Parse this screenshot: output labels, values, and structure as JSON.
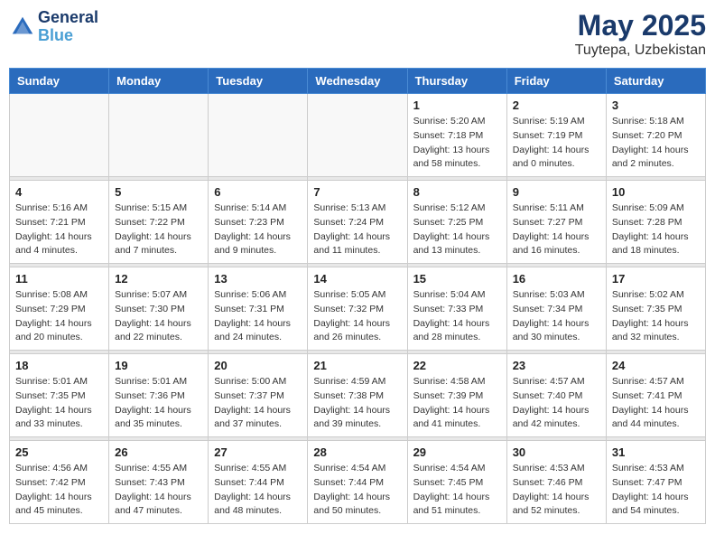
{
  "header": {
    "logo_line1": "General",
    "logo_line2": "Blue",
    "month_title": "May 2025",
    "location": "Tuytepa, Uzbekistan"
  },
  "days_of_week": [
    "Sunday",
    "Monday",
    "Tuesday",
    "Wednesday",
    "Thursday",
    "Friday",
    "Saturday"
  ],
  "weeks": [
    {
      "days": [
        {
          "num": "",
          "info": ""
        },
        {
          "num": "",
          "info": ""
        },
        {
          "num": "",
          "info": ""
        },
        {
          "num": "",
          "info": ""
        },
        {
          "num": "1",
          "info": "Sunrise: 5:20 AM\nSunset: 7:18 PM\nDaylight: 13 hours\nand 58 minutes."
        },
        {
          "num": "2",
          "info": "Sunrise: 5:19 AM\nSunset: 7:19 PM\nDaylight: 14 hours\nand 0 minutes."
        },
        {
          "num": "3",
          "info": "Sunrise: 5:18 AM\nSunset: 7:20 PM\nDaylight: 14 hours\nand 2 minutes."
        }
      ]
    },
    {
      "days": [
        {
          "num": "4",
          "info": "Sunrise: 5:16 AM\nSunset: 7:21 PM\nDaylight: 14 hours\nand 4 minutes."
        },
        {
          "num": "5",
          "info": "Sunrise: 5:15 AM\nSunset: 7:22 PM\nDaylight: 14 hours\nand 7 minutes."
        },
        {
          "num": "6",
          "info": "Sunrise: 5:14 AM\nSunset: 7:23 PM\nDaylight: 14 hours\nand 9 minutes."
        },
        {
          "num": "7",
          "info": "Sunrise: 5:13 AM\nSunset: 7:24 PM\nDaylight: 14 hours\nand 11 minutes."
        },
        {
          "num": "8",
          "info": "Sunrise: 5:12 AM\nSunset: 7:25 PM\nDaylight: 14 hours\nand 13 minutes."
        },
        {
          "num": "9",
          "info": "Sunrise: 5:11 AM\nSunset: 7:27 PM\nDaylight: 14 hours\nand 16 minutes."
        },
        {
          "num": "10",
          "info": "Sunrise: 5:09 AM\nSunset: 7:28 PM\nDaylight: 14 hours\nand 18 minutes."
        }
      ]
    },
    {
      "days": [
        {
          "num": "11",
          "info": "Sunrise: 5:08 AM\nSunset: 7:29 PM\nDaylight: 14 hours\nand 20 minutes."
        },
        {
          "num": "12",
          "info": "Sunrise: 5:07 AM\nSunset: 7:30 PM\nDaylight: 14 hours\nand 22 minutes."
        },
        {
          "num": "13",
          "info": "Sunrise: 5:06 AM\nSunset: 7:31 PM\nDaylight: 14 hours\nand 24 minutes."
        },
        {
          "num": "14",
          "info": "Sunrise: 5:05 AM\nSunset: 7:32 PM\nDaylight: 14 hours\nand 26 minutes."
        },
        {
          "num": "15",
          "info": "Sunrise: 5:04 AM\nSunset: 7:33 PM\nDaylight: 14 hours\nand 28 minutes."
        },
        {
          "num": "16",
          "info": "Sunrise: 5:03 AM\nSunset: 7:34 PM\nDaylight: 14 hours\nand 30 minutes."
        },
        {
          "num": "17",
          "info": "Sunrise: 5:02 AM\nSunset: 7:35 PM\nDaylight: 14 hours\nand 32 minutes."
        }
      ]
    },
    {
      "days": [
        {
          "num": "18",
          "info": "Sunrise: 5:01 AM\nSunset: 7:35 PM\nDaylight: 14 hours\nand 33 minutes."
        },
        {
          "num": "19",
          "info": "Sunrise: 5:01 AM\nSunset: 7:36 PM\nDaylight: 14 hours\nand 35 minutes."
        },
        {
          "num": "20",
          "info": "Sunrise: 5:00 AM\nSunset: 7:37 PM\nDaylight: 14 hours\nand 37 minutes."
        },
        {
          "num": "21",
          "info": "Sunrise: 4:59 AM\nSunset: 7:38 PM\nDaylight: 14 hours\nand 39 minutes."
        },
        {
          "num": "22",
          "info": "Sunrise: 4:58 AM\nSunset: 7:39 PM\nDaylight: 14 hours\nand 41 minutes."
        },
        {
          "num": "23",
          "info": "Sunrise: 4:57 AM\nSunset: 7:40 PM\nDaylight: 14 hours\nand 42 minutes."
        },
        {
          "num": "24",
          "info": "Sunrise: 4:57 AM\nSunset: 7:41 PM\nDaylight: 14 hours\nand 44 minutes."
        }
      ]
    },
    {
      "days": [
        {
          "num": "25",
          "info": "Sunrise: 4:56 AM\nSunset: 7:42 PM\nDaylight: 14 hours\nand 45 minutes."
        },
        {
          "num": "26",
          "info": "Sunrise: 4:55 AM\nSunset: 7:43 PM\nDaylight: 14 hours\nand 47 minutes."
        },
        {
          "num": "27",
          "info": "Sunrise: 4:55 AM\nSunset: 7:44 PM\nDaylight: 14 hours\nand 48 minutes."
        },
        {
          "num": "28",
          "info": "Sunrise: 4:54 AM\nSunset: 7:44 PM\nDaylight: 14 hours\nand 50 minutes."
        },
        {
          "num": "29",
          "info": "Sunrise: 4:54 AM\nSunset: 7:45 PM\nDaylight: 14 hours\nand 51 minutes."
        },
        {
          "num": "30",
          "info": "Sunrise: 4:53 AM\nSunset: 7:46 PM\nDaylight: 14 hours\nand 52 minutes."
        },
        {
          "num": "31",
          "info": "Sunrise: 4:53 AM\nSunset: 7:47 PM\nDaylight: 14 hours\nand 54 minutes."
        }
      ]
    }
  ]
}
